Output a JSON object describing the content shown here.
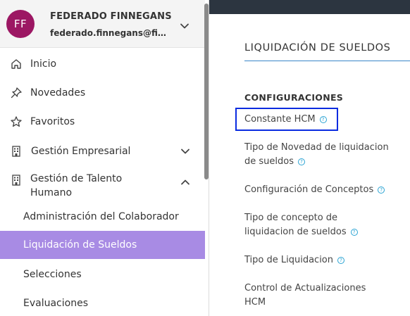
{
  "user": {
    "initials": "FF",
    "name": "FEDERADO FINNEGANS",
    "email": "federado.finnegans@fin…"
  },
  "nav": {
    "items": [
      {
        "label": "Inicio",
        "icon": "home-icon"
      },
      {
        "label": "Novedades",
        "icon": "pin-icon"
      },
      {
        "label": "Favoritos",
        "icon": "star-icon"
      },
      {
        "label": "Gestión Empresarial",
        "icon": "building-icon",
        "expanded": false
      },
      {
        "label": "Gestión de Talento",
        "label_line2": "Humano",
        "icon": "building-icon",
        "expanded": true
      }
    ],
    "subitems": [
      {
        "label": "Administración del Colaborador",
        "active": false
      },
      {
        "label": "Liquidación de Sueldos",
        "active": true
      },
      {
        "label": "Selecciones",
        "active": false
      },
      {
        "label": "Evaluaciones",
        "active": false
      }
    ]
  },
  "main": {
    "title": "LIQUIDACIÓN DE SUELDOS",
    "section": "CONFIGURACIONES",
    "links": [
      {
        "label": "Constante HCM",
        "info": "?"
      },
      {
        "label": "Tipo de Novedad de liquidacion de sueldos",
        "line1": "Tipo de Novedad de liquidacion",
        "line2": "de sueldos",
        "info": "?"
      },
      {
        "label": "Configuración de Conceptos",
        "info": "?"
      },
      {
        "label": "Tipo de concepto de liquidacion de sueldos",
        "line1": "Tipo de concepto de",
        "line2": "liquidacion de sueldos",
        "info": "?"
      },
      {
        "label": "Tipo de Liquidacion",
        "info": "?"
      },
      {
        "label": "Control de Actualizaciones HCM",
        "line1": "Control de Actualizaciones",
        "line2": "HCM"
      }
    ]
  },
  "colors": {
    "avatar": "#9c1763",
    "active_item": "#a88be4",
    "topbar": "#2c3540",
    "highlight_border": "#0a2be0",
    "info_icon": "#2aa3d3",
    "title_rule": "#3a86c8"
  }
}
